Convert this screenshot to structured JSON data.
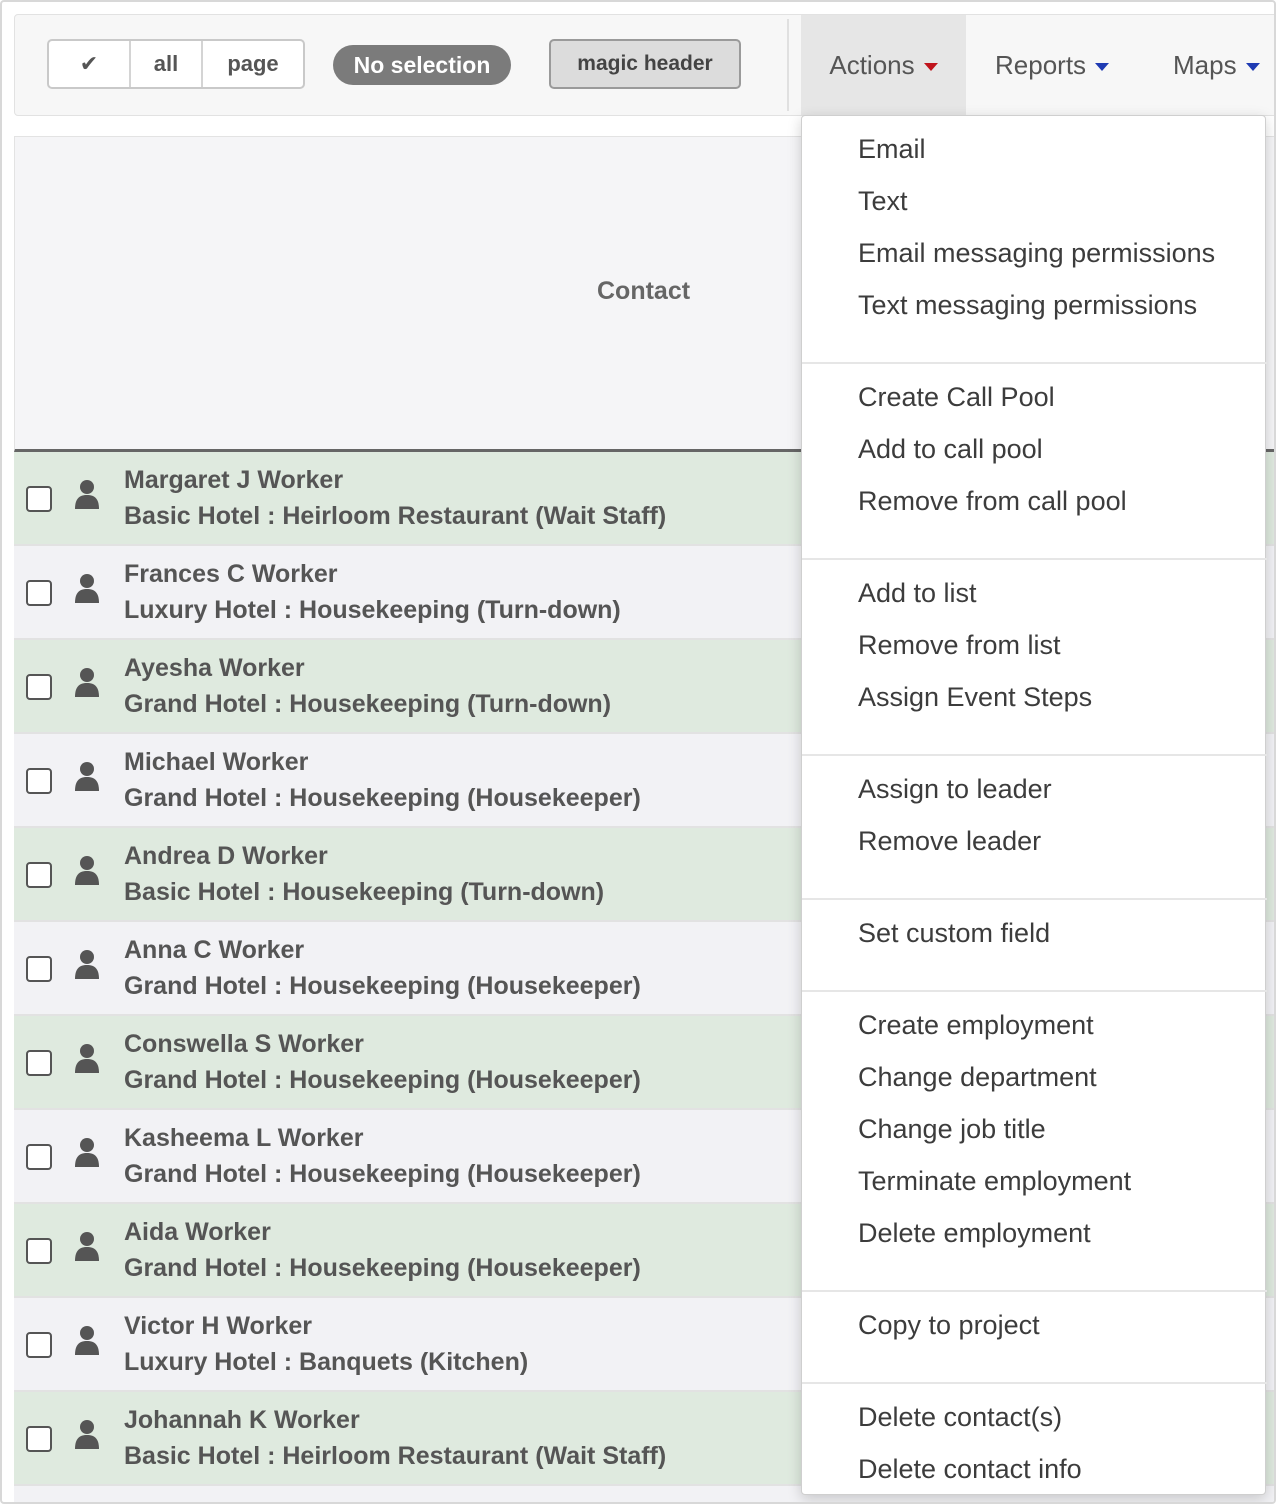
{
  "toolbar": {
    "select_check": "✔",
    "select_all": "all",
    "select_page": "page",
    "selection_status": "No selection",
    "magic_header": "magic header",
    "actions": "Actions",
    "reports": "Reports",
    "maps": "Maps"
  },
  "table": {
    "column_header": "Contact",
    "rows": [
      {
        "name": "Margaret J Worker",
        "dept": "Basic Hotel : Heirloom Restaurant (Wait Staff)"
      },
      {
        "name": "Frances C Worker",
        "dept": "Luxury Hotel : Housekeeping (Turn-down)"
      },
      {
        "name": "Ayesha Worker",
        "dept": "Grand Hotel : Housekeeping (Turn-down)"
      },
      {
        "name": "Michael Worker",
        "dept": "Grand Hotel : Housekeeping (Housekeeper)"
      },
      {
        "name": "Andrea D Worker",
        "dept": "Basic Hotel : Housekeeping (Turn-down)"
      },
      {
        "name": "Anna C Worker",
        "dept": "Grand Hotel : Housekeeping (Housekeeper)"
      },
      {
        "name": "Conswella S Worker",
        "dept": "Grand Hotel : Housekeeping (Housekeeper)"
      },
      {
        "name": "Kasheema L Worker",
        "dept": "Grand Hotel : Housekeeping (Housekeeper)"
      },
      {
        "name": "Aida Worker",
        "dept": "Grand Hotel : Housekeeping (Housekeeper)"
      },
      {
        "name": "Victor H Worker",
        "dept": "Luxury Hotel : Banquets (Kitchen)"
      },
      {
        "name": "Johannah K Worker",
        "dept": "Basic Hotel : Heirloom Restaurant (Wait Staff)"
      }
    ]
  },
  "actions_menu": {
    "groups": [
      [
        "Email",
        "Text",
        "Email messaging permissions",
        "Text messaging permissions"
      ],
      [
        "Create Call Pool",
        "Add to call pool",
        "Remove from call pool"
      ],
      [
        "Add to list",
        "Remove from list",
        "Assign Event Steps"
      ],
      [
        "Assign to leader",
        "Remove leader"
      ],
      [
        "Set custom field"
      ],
      [
        "Create employment",
        "Change department",
        "Change job title",
        "Terminate employment",
        "Delete employment"
      ],
      [
        "Copy to project"
      ],
      [
        "Delete contact(s)",
        "Delete contact info"
      ]
    ]
  },
  "colors": {
    "row_green": "#dfeadf",
    "row_plain": "#f2f2f5",
    "caret_blue": "#1f3bb3",
    "caret_red": "#c0141c",
    "pill_gray": "#7b7b7b"
  }
}
